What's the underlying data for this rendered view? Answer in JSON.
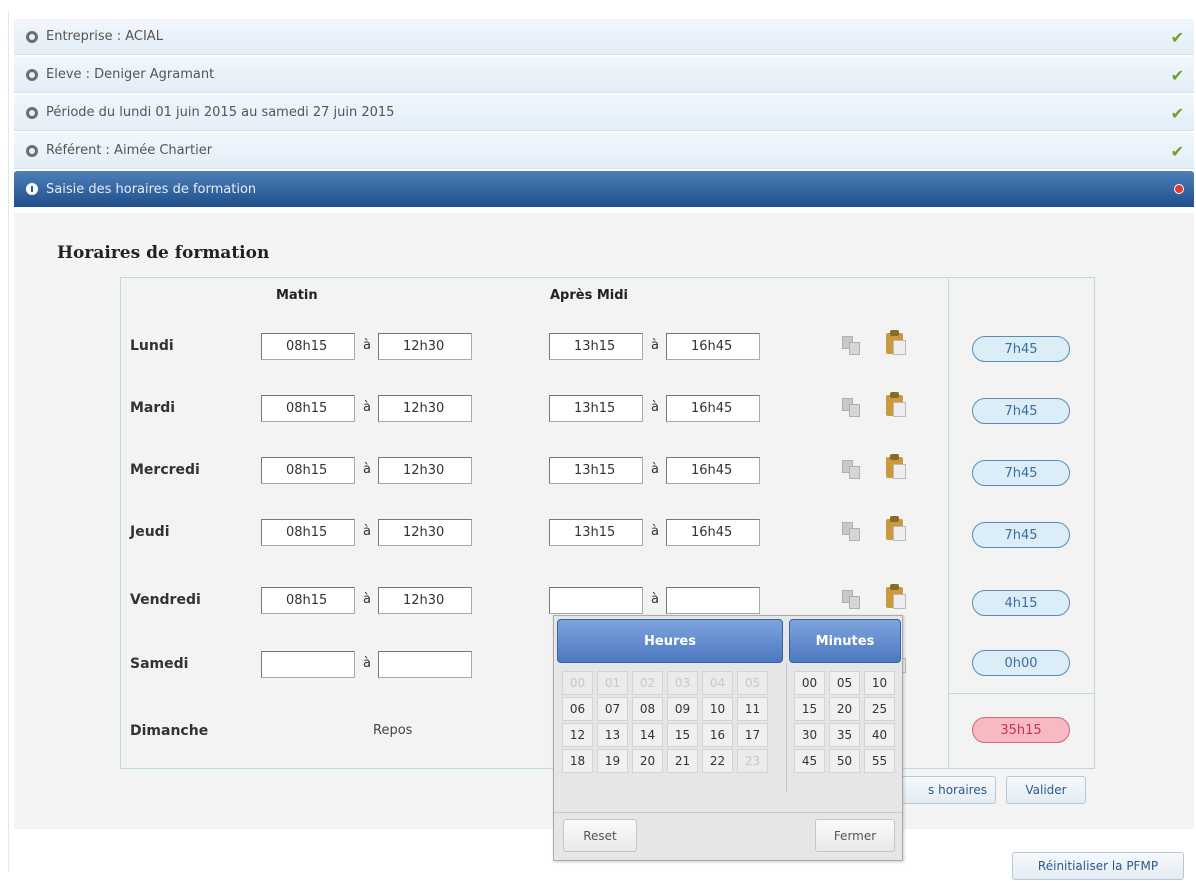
{
  "accordion": [
    {
      "label": "Entreprise : ACIAL",
      "done": true
    },
    {
      "label": "Eleve : Deniger Agramant",
      "done": true
    },
    {
      "label": "Période du lundi 01 juin 2015 au samedi 27 juin 2015",
      "done": true
    },
    {
      "label": "Référent : Aimée Chartier",
      "done": true
    },
    {
      "label": "Saisie des horaires de formation",
      "active": true
    }
  ],
  "section": {
    "title": "Horaires de formation"
  },
  "columns": {
    "morning": "Matin",
    "afternoon": "Après Midi"
  },
  "separator": "à",
  "days": [
    {
      "label": "Lundi",
      "am_start": "08h15",
      "am_end": "12h30",
      "pm_start": "13h15",
      "pm_end": "16h45",
      "total": "7h45"
    },
    {
      "label": "Mardi",
      "am_start": "08h15",
      "am_end": "12h30",
      "pm_start": "13h15",
      "pm_end": "16h45",
      "total": "7h45"
    },
    {
      "label": "Mercredi",
      "am_start": "08h15",
      "am_end": "12h30",
      "pm_start": "13h15",
      "pm_end": "16h45",
      "total": "7h45"
    },
    {
      "label": "Jeudi",
      "am_start": "08h15",
      "am_end": "12h30",
      "pm_start": "13h15",
      "pm_end": "16h45",
      "total": "7h45"
    },
    {
      "label": "Vendredi",
      "am_start": "08h15",
      "am_end": "12h30",
      "pm_start": "",
      "pm_end": "",
      "total": "4h15"
    },
    {
      "label": "Samedi",
      "am_start": "",
      "am_end": "",
      "pm_start": "",
      "pm_end": "",
      "total": "0h00"
    },
    {
      "label": "Dimanche",
      "rest_label": "Repos"
    }
  ],
  "grand_total": "35h15",
  "buttons": {
    "clear_partial": "s horaires",
    "validate": "Valider",
    "reset_pfmp": "Réinitialiser la PFMP"
  },
  "picker": {
    "hours_title": "Heures",
    "minutes_title": "Minutes",
    "hours": [
      "00",
      "01",
      "02",
      "03",
      "04",
      "05",
      "06",
      "07",
      "08",
      "09",
      "10",
      "11",
      "12",
      "13",
      "14",
      "15",
      "16",
      "17",
      "18",
      "19",
      "20",
      "21",
      "22",
      "23"
    ],
    "disabled_hours": [
      "00",
      "01",
      "02",
      "03",
      "04",
      "05",
      "23"
    ],
    "minutes": [
      "00",
      "05",
      "10",
      "15",
      "20",
      "25",
      "30",
      "35",
      "40",
      "45",
      "50",
      "55"
    ],
    "reset": "Reset",
    "close": "Fermer"
  },
  "colors": {
    "accent": "#1f4f8c",
    "check": "#6aa32b",
    "total_pill": "#dbeef7",
    "grand_total": "#f7b9c2"
  },
  "icons": [
    "radio-bullet-icon",
    "checkmark-icon",
    "collapse-icon",
    "close-icon",
    "copy-icon",
    "paste-icon"
  ]
}
